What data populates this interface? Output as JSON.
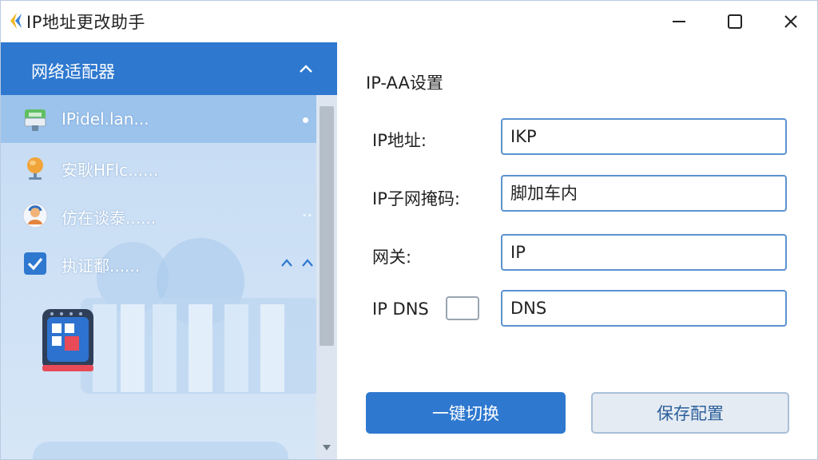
{
  "window": {
    "title": "IP地址更改助手"
  },
  "sidebar": {
    "header": "网络适配器",
    "items": [
      {
        "label": "IPidel.lan...",
        "icon": "network-adapter-icon"
      },
      {
        "label": "安耿HFlc......",
        "icon": "globe-icon"
      },
      {
        "label": "仿在谈泰......",
        "icon": "user-avatar-icon"
      },
      {
        "label": "执证鄱......",
        "icon": "checkbox-checked-icon"
      }
    ]
  },
  "form": {
    "section_title": "IP-AA设置",
    "ip_label": "IP地址:",
    "ip_value": "IKP",
    "subnet_label": "IP子网掩码:",
    "subnet_value": "脚加车内",
    "gateway_label": "网关:",
    "gateway_value": "IP",
    "dns_label": "IP DNS",
    "dns_value": "DNS"
  },
  "buttons": {
    "switch": "一键切换",
    "save": "保存配置"
  },
  "colors": {
    "accent": "#2e78cf",
    "sidebar_bg": "#c9def5",
    "selected": "#9cc3ec"
  }
}
